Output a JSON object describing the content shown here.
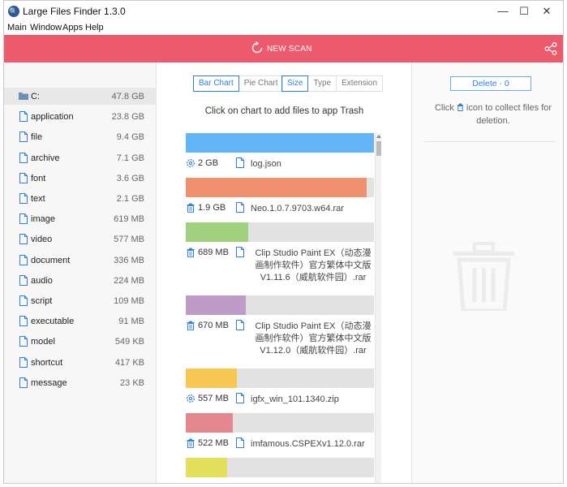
{
  "window": {
    "title": "Large Files Finder 1.3.0",
    "controls": {
      "minimize": "—",
      "maximize": "☐",
      "close": "✕"
    }
  },
  "menu": {
    "main": "Main",
    "window": "Window",
    "apps": "Apps",
    "help": "Help"
  },
  "toolbar": {
    "new_scan": "NEW SCAN",
    "accent_color": "#ec5a6b",
    "scan_icon": "refresh-icon",
    "share_icon": "share-icon"
  },
  "sidebar": {
    "items": [
      {
        "label": "C:",
        "size": "47.8 GB",
        "icon": "folder-icon",
        "selected": true
      },
      {
        "label": "application",
        "size": "23.8 GB",
        "icon": "file-icon"
      },
      {
        "label": "file",
        "size": "9.4 GB",
        "icon": "file-icon"
      },
      {
        "label": "archive",
        "size": "7.1 GB",
        "icon": "file-icon"
      },
      {
        "label": "font",
        "size": "3.6 GB",
        "icon": "file-icon"
      },
      {
        "label": "text",
        "size": "2.1 GB",
        "icon": "file-icon"
      },
      {
        "label": "image",
        "size": "619 MB",
        "icon": "file-icon"
      },
      {
        "label": "video",
        "size": "577 MB",
        "icon": "file-icon"
      },
      {
        "label": "document",
        "size": "336 MB",
        "icon": "file-icon"
      },
      {
        "label": "audio",
        "size": "224 MB",
        "icon": "file-icon"
      },
      {
        "label": "script",
        "size": "109 MB",
        "icon": "file-icon"
      },
      {
        "label": "executable",
        "size": "91 MB",
        "icon": "file-icon"
      },
      {
        "label": "model",
        "size": "549 KB",
        "icon": "file-icon"
      },
      {
        "label": "shortcut",
        "size": "417 KB",
        "icon": "file-icon"
      },
      {
        "label": "message",
        "size": "23 KB",
        "icon": "file-icon"
      }
    ]
  },
  "center": {
    "chart_tabs": [
      {
        "label": "Bar Chart",
        "active": true
      },
      {
        "label": "Pie Chart",
        "active": false
      }
    ],
    "sort_tabs": [
      {
        "label": "Size",
        "active": true
      },
      {
        "label": "Type",
        "active": false
      },
      {
        "label": "Extension",
        "active": false
      }
    ],
    "hint": "Click on chart to add files to app Trash"
  },
  "files": [
    {
      "size": "2 GB",
      "name": "log.json",
      "fraction": 1.0,
      "color": "#64b5f6",
      "action_icon": "gear-icon"
    },
    {
      "size": "1.9 GB",
      "name": "Neo.1.0.7.9703.w64.rar",
      "fraction": 0.96,
      "color": "#f0916e",
      "action_icon": "trash-icon"
    },
    {
      "size": "689 MB",
      "name": "Clip Studio Paint EX（动态漫画制作软件）官方繁体中文版V1.11.6（威航软件园）.rar",
      "fraction": 0.33,
      "color": "#9fd17f",
      "action_icon": "trash-icon"
    },
    {
      "size": "670 MB",
      "name": "Clip Studio Paint EX（动态漫画制作软件）官方繁体中文版V1.12.0（威航软件园）.rar",
      "fraction": 0.32,
      "color": "#bf9bc8",
      "action_icon": "trash-icon"
    },
    {
      "size": "557 MB",
      "name": "igfx_win_101.1340.zip",
      "fraction": 0.27,
      "color": "#f7c653",
      "action_icon": "gear-icon"
    },
    {
      "size": "522 MB",
      "name": "imfamous.CSPEXv1.12.0.rar",
      "fraction": 0.25,
      "color": "#e4878f",
      "action_icon": "trash-icon"
    },
    {
      "size": "",
      "name": "",
      "fraction": 0.22,
      "color": "#e3e05c",
      "action_icon": ""
    }
  ],
  "right": {
    "delete_label": "Delete · 0",
    "collect_before": "Click",
    "collect_after": "icon to collect files for deletion.",
    "empty_icon": "trash-icon"
  }
}
